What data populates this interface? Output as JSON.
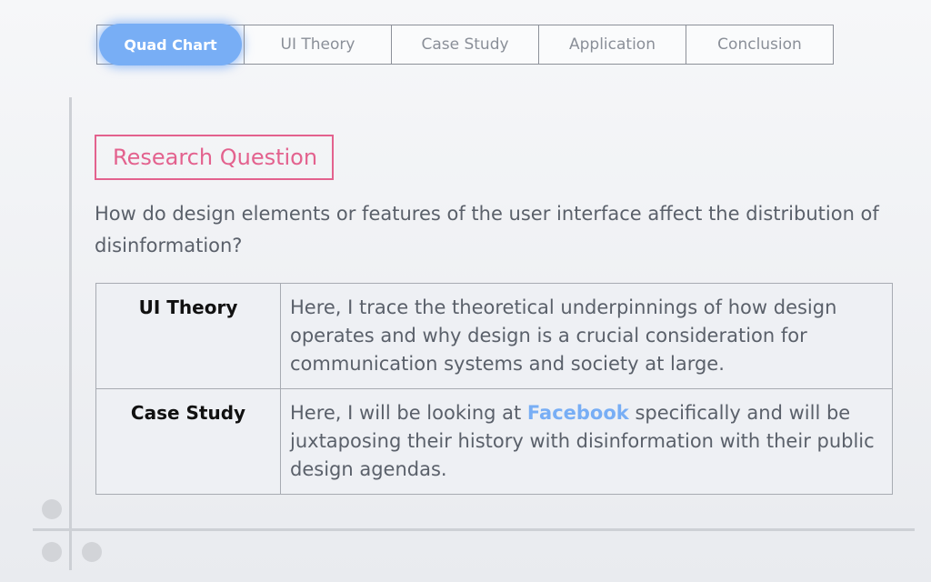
{
  "nav": {
    "tabs": [
      {
        "label": "Quad Chart",
        "active": true
      },
      {
        "label": "UI Theory",
        "active": false
      },
      {
        "label": "Case Study",
        "active": false
      },
      {
        "label": "Application",
        "active": false
      },
      {
        "label": "Conclusion",
        "active": false
      }
    ]
  },
  "heading": {
    "label": "Research Question"
  },
  "question": {
    "text": "How do design elements or features of the user interface affect the distribution of disinformation?"
  },
  "table": {
    "rows": [
      {
        "label": "UI Theory",
        "text": "Here, I trace the theoretical underpinnings of how design operates and why design is a crucial consideration for communication systems and society at large."
      },
      {
        "label": "Case Study",
        "text_before": "Here, I will be looking at ",
        "highlight": "Facebook",
        "text_after": " specifically and will be juxtaposing their history with disinformation with their public design agendas."
      }
    ]
  },
  "colors": {
    "accent_blue": "#78aef5",
    "accent_pink": "#e3628e",
    "text_gray": "#5a606a",
    "frame_gray": "#cdd0d5"
  }
}
